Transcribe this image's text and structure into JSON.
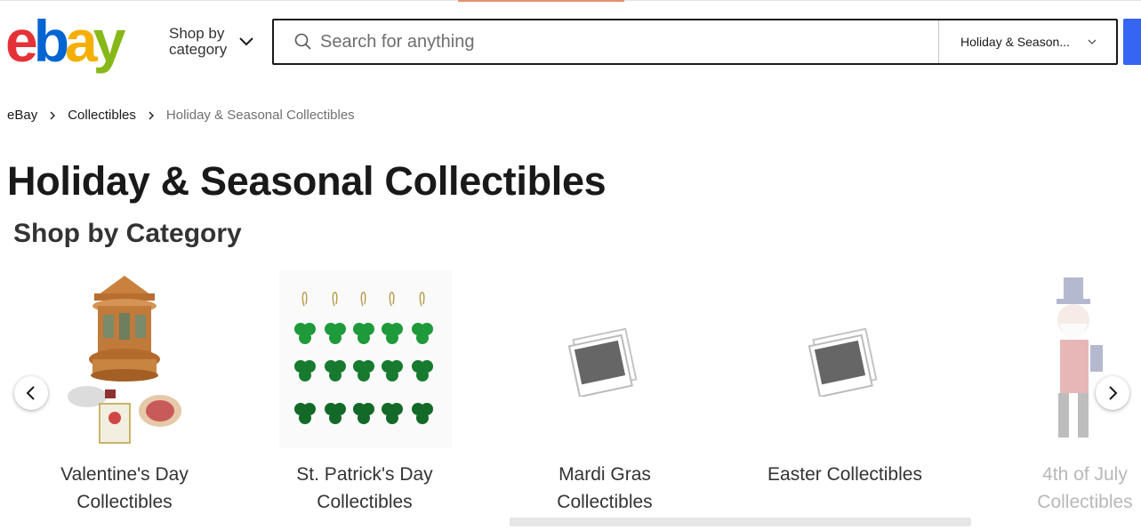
{
  "header": {
    "logo_letters": [
      "e",
      "b",
      "a",
      "y"
    ],
    "brand_colors": {
      "e": "#e53238",
      "b": "#0064d2",
      "a": "#f5af02",
      "y": "#86b817"
    },
    "shop_by_category_label": "Shop by category",
    "search": {
      "placeholder": "Search for anything",
      "value": "",
      "category_selected": "Holiday & Season..."
    }
  },
  "breadcrumb": [
    {
      "label": "eBay"
    },
    {
      "label": "Collectibles"
    },
    {
      "label": "Holiday & Seasonal Collectibles"
    }
  ],
  "page_title": "Holiday & Seasonal Collectibles",
  "section_title": "Shop by Category",
  "categories": [
    {
      "label_line1": "Valentine's Day",
      "label_line2": "Collectibles",
      "image": "honeycomb-carousel-ornament"
    },
    {
      "label_line1": "St. Patrick's Day",
      "label_line2": "Collectibles",
      "image": "shamrock-ornaments"
    },
    {
      "label_line1": "Mardi Gras",
      "label_line2": "Collectibles",
      "image": "placeholder-photo-icon"
    },
    {
      "label_line1": "Easter Collectibles",
      "label_line2": "",
      "image": "placeholder-photo-icon"
    },
    {
      "label_line1": "4th of July",
      "label_line2": "Collectibles",
      "image": "uncle-sam-figure"
    }
  ],
  "accent_color": "#3665f3"
}
